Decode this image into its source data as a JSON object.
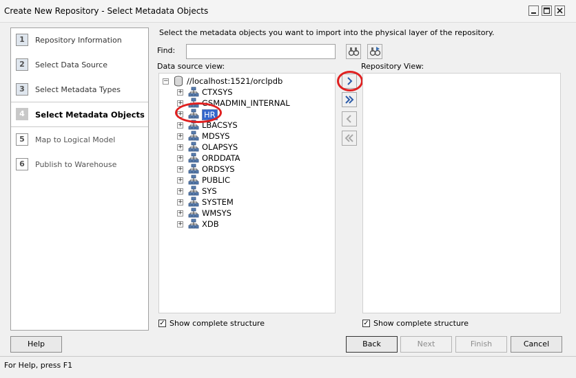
{
  "window": {
    "title": "Create New Repository - Select Metadata Objects",
    "minimize_icon": "minimize-icon",
    "maximize_icon": "maximize-icon",
    "close_icon": "close-icon"
  },
  "wizard_steps": [
    {
      "number": "1",
      "label": "Repository Information",
      "state": "done"
    },
    {
      "number": "2",
      "label": "Select Data Source",
      "state": "done"
    },
    {
      "number": "3",
      "label": "Select Metadata Types",
      "state": "done"
    },
    {
      "number": "4",
      "label": "Select Metadata Objects",
      "state": "active"
    },
    {
      "number": "5",
      "label": "Map to Logical Model",
      "state": "future"
    },
    {
      "number": "6",
      "label": "Publish to Warehouse",
      "state": "future"
    }
  ],
  "instruction": "Select the metadata objects you want to import into the physical layer of the repository.",
  "find": {
    "label": "Find:",
    "value": "",
    "find_icon": "binoculars-icon",
    "find_again_icon": "binoculars-next-icon"
  },
  "data_source_view": {
    "label": "Data source view:",
    "root": "//localhost:1521/orclpdb",
    "schemas": [
      "CTXSYS",
      "GSMADMIN_INTERNAL",
      "HR",
      "LBACSYS",
      "MDSYS",
      "OLAPSYS",
      "ORDDATA",
      "ORDSYS",
      "PUBLIC",
      "SYS",
      "SYSTEM",
      "WMSYS",
      "XDB"
    ],
    "selected": "HR",
    "show_complete_structure": "Show complete structure"
  },
  "repository_view": {
    "label": "Repository View:",
    "show_complete_structure": "Show complete structure"
  },
  "move_buttons": [
    "import-selected-icon",
    "import-all-icon",
    "remove-selected-icon",
    "remove-all-icon"
  ],
  "buttons": {
    "help": "Help",
    "back": "Back",
    "next": "Next",
    "finish": "Finish",
    "cancel": "Cancel"
  },
  "status": "For Help, press F1",
  "colors": {
    "highlight": "#e02020",
    "selection": "#3366cc"
  }
}
